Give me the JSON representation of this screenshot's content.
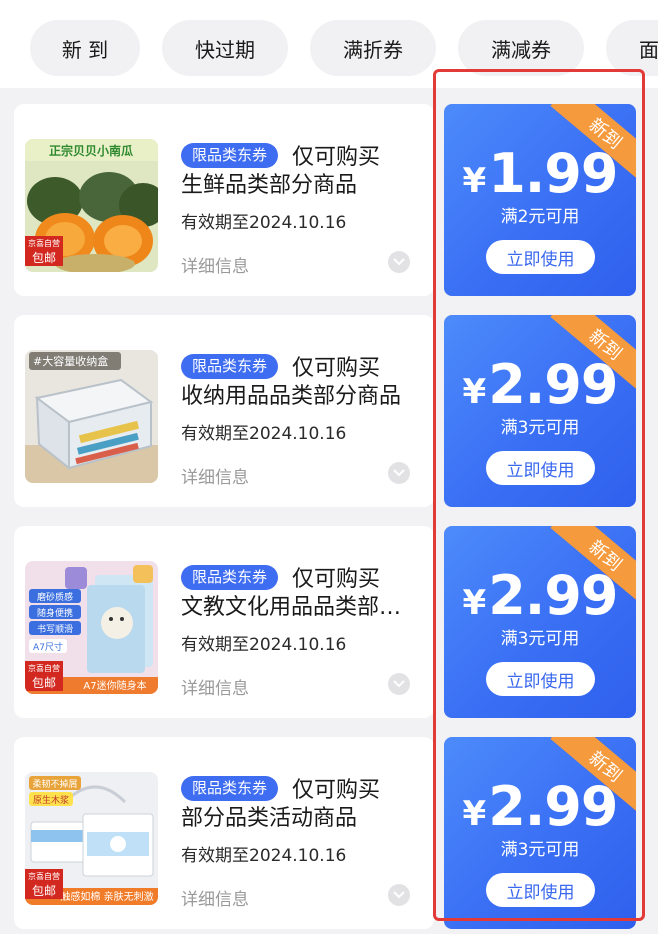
{
  "filters": [
    "新 到",
    "快过期",
    "满折券",
    "满减券",
    "面"
  ],
  "colors": {
    "accent": "#3f6df1",
    "ribbon": "#f59a3d",
    "highlight": "#e23a36"
  },
  "coupons": [
    {
      "tag": "限品类东券",
      "title_line1": "仅可购买",
      "title_line2": "生鲜品类部分商品",
      "validity": "有效期至2024.10.16",
      "details": "详细信息",
      "ribbon": "新到",
      "currency": "¥",
      "amount": "1.99",
      "condition": "满2元可用",
      "button": "立即使用",
      "image": {
        "banner": "正宗贝贝小南瓜",
        "badge_top": "京喜自营",
        "badge_bottom": "包邮"
      }
    },
    {
      "tag": "限品类东券",
      "title_line1": "仅可购买",
      "title_line2": "收纳用品品类部分商品",
      "validity": "有效期至2024.10.16",
      "details": "详细信息",
      "ribbon": "新到",
      "currency": "¥",
      "amount": "2.99",
      "condition": "满3元可用",
      "button": "立即使用",
      "image": {
        "banner": "#大容量收纳盒"
      }
    },
    {
      "tag": "限品类东券",
      "title_line1": "仅可购买",
      "title_line2": "文教文化用品品类部分商品",
      "validity": "有效期至2024.10.16",
      "details": "详细信息",
      "ribbon": "新到",
      "currency": "¥",
      "amount": "2.99",
      "condition": "满3元可用",
      "button": "立即使用",
      "image": {
        "chips": [
          "磨砂质感",
          "随身便携",
          "书写顺滑"
        ],
        "size": "A7尺寸",
        "badge_top": "京喜自营",
        "badge_bottom": "包邮",
        "footer": "A7迷你随身本"
      }
    },
    {
      "tag": "限品类东券",
      "title_line1": "仅可购买",
      "title_line2": "部分品类活动商品",
      "validity": "有效期至2024.10.16",
      "details": "详细信息",
      "ribbon": "新到",
      "currency": "¥",
      "amount": "2.99",
      "condition": "满3元可用",
      "button": "立即使用",
      "image": {
        "label1": "柔韧不掉屑",
        "label2": "原生木浆",
        "badge_top": "京喜自营",
        "badge_bottom": "包邮",
        "footer": "触感如棉  亲肤无刺激"
      }
    }
  ]
}
